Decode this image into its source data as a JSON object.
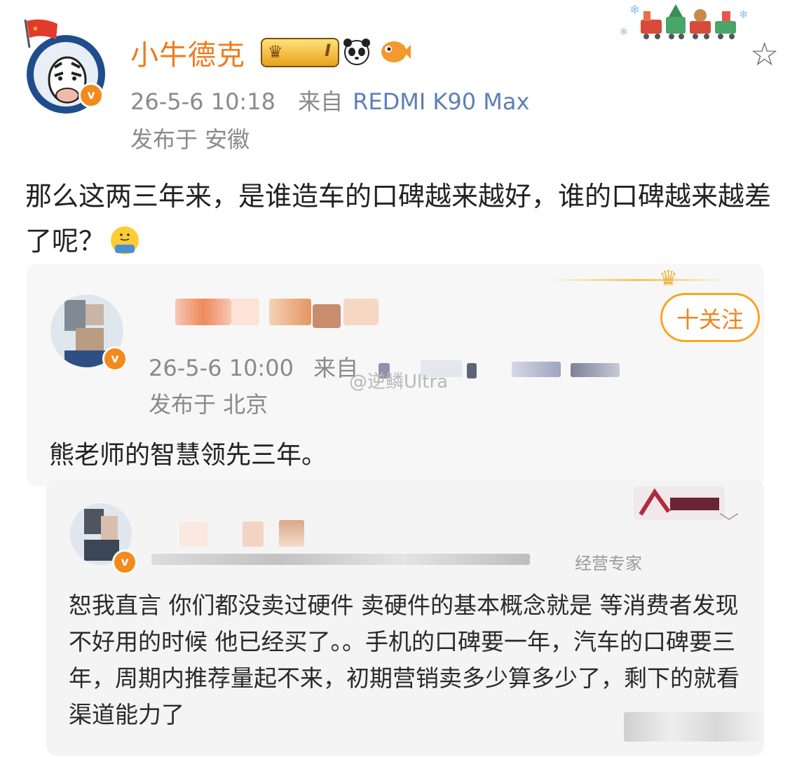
{
  "post": {
    "username": "小牛德克",
    "level_badge": "I",
    "badges": [
      "crown-level-badge",
      "panda-badge",
      "fish-badge"
    ],
    "time": "26-5-6 10:18",
    "source_prefix": "来自",
    "device": "REDMI K90 Max",
    "location": "发布于 安徽",
    "text": "那么这两三年来，是谁造车的口碑越来越好，谁的口碑越来越差了呢？",
    "text_emoji": "shrug-emoji"
  },
  "quoted_1": {
    "follow_label": "十关注",
    "time": "26-5-6 10:00",
    "source_prefix": "来自",
    "location": "发布于 北京",
    "watermark": "@逆鳞Ultra",
    "text": "熊老师的智慧领先三年。"
  },
  "quoted_2": {
    "meta_fragment": "经营专家",
    "text": "恕我直言 你们都没卖过硬件 卖硬件的基本概念就是 等消费者发现不好用的时候 他已经买了。。手机的口碑要一年，汽车的口碑要三年，周期内推荐量起不来，初期营销卖多少算多少了，剩下的就看渠道能力了"
  },
  "colors": {
    "username": "#f07a1b",
    "device_link": "#5d7fb5",
    "follow_border": "#f6a623",
    "meta_gray": "#8a8a8a"
  }
}
